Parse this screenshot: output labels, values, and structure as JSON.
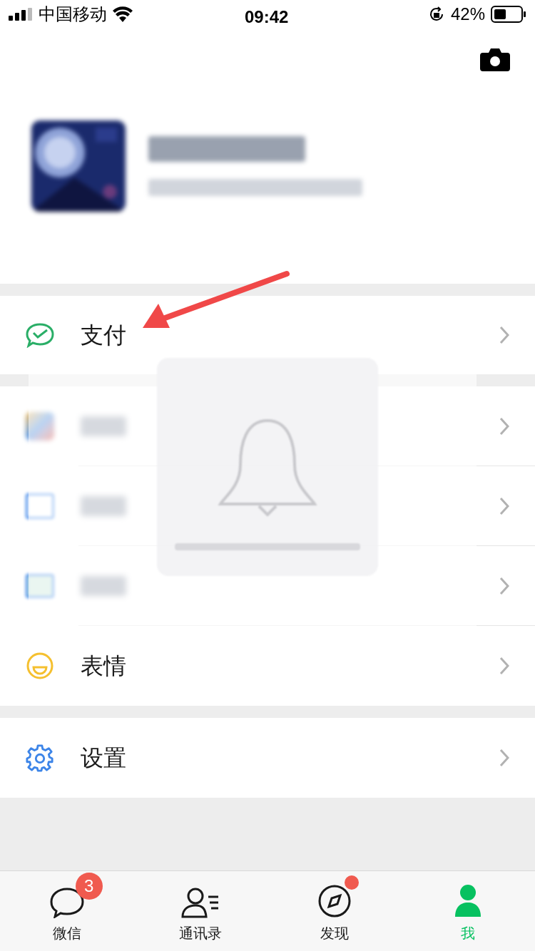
{
  "status_bar": {
    "carrier": "中国移动",
    "time": "09:42",
    "battery": "42%"
  },
  "menu_groups": [
    [
      {
        "kind": "pay",
        "label": "支付"
      }
    ],
    [
      {
        "kind": "favorites"
      },
      {
        "kind": "album"
      },
      {
        "kind": "cards"
      },
      {
        "kind": "sticker",
        "label": "表情"
      }
    ],
    [
      {
        "kind": "settings",
        "label": "设置"
      }
    ]
  ],
  "tabs": [
    {
      "kind": "chat",
      "label": "微信",
      "badge": "3",
      "dot": false,
      "selected": false
    },
    {
      "kind": "contacts",
      "label": "通讯录",
      "dot": false,
      "selected": false
    },
    {
      "kind": "discover",
      "label": "发现",
      "dot": true,
      "selected": false
    },
    {
      "kind": "me",
      "label": "我",
      "dot": false,
      "selected": true
    }
  ]
}
